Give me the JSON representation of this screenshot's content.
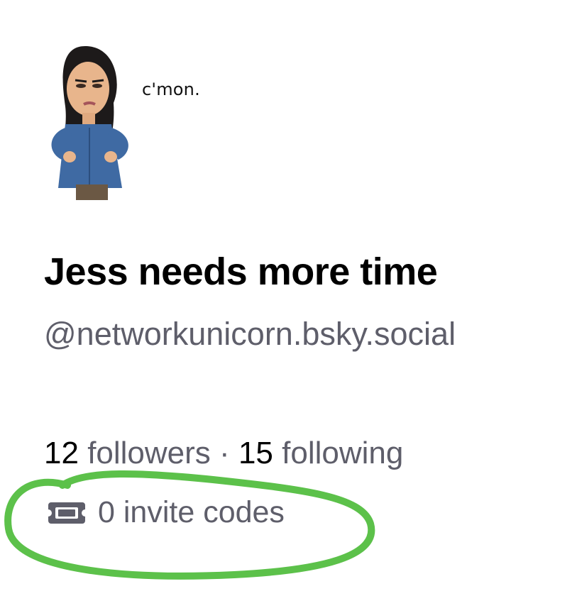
{
  "profile": {
    "bubble_text": "c'mon.",
    "display_name": "Jess needs more time",
    "handle": "@networkunicorn.bsky.social",
    "followers_count": "12",
    "followers_label": "followers",
    "separator": "·",
    "following_count": "15",
    "following_label": "following"
  },
  "invites": {
    "icon": "ticket-icon",
    "label": "0 invite codes"
  },
  "annotation": {
    "color": "#5cc14a"
  }
}
